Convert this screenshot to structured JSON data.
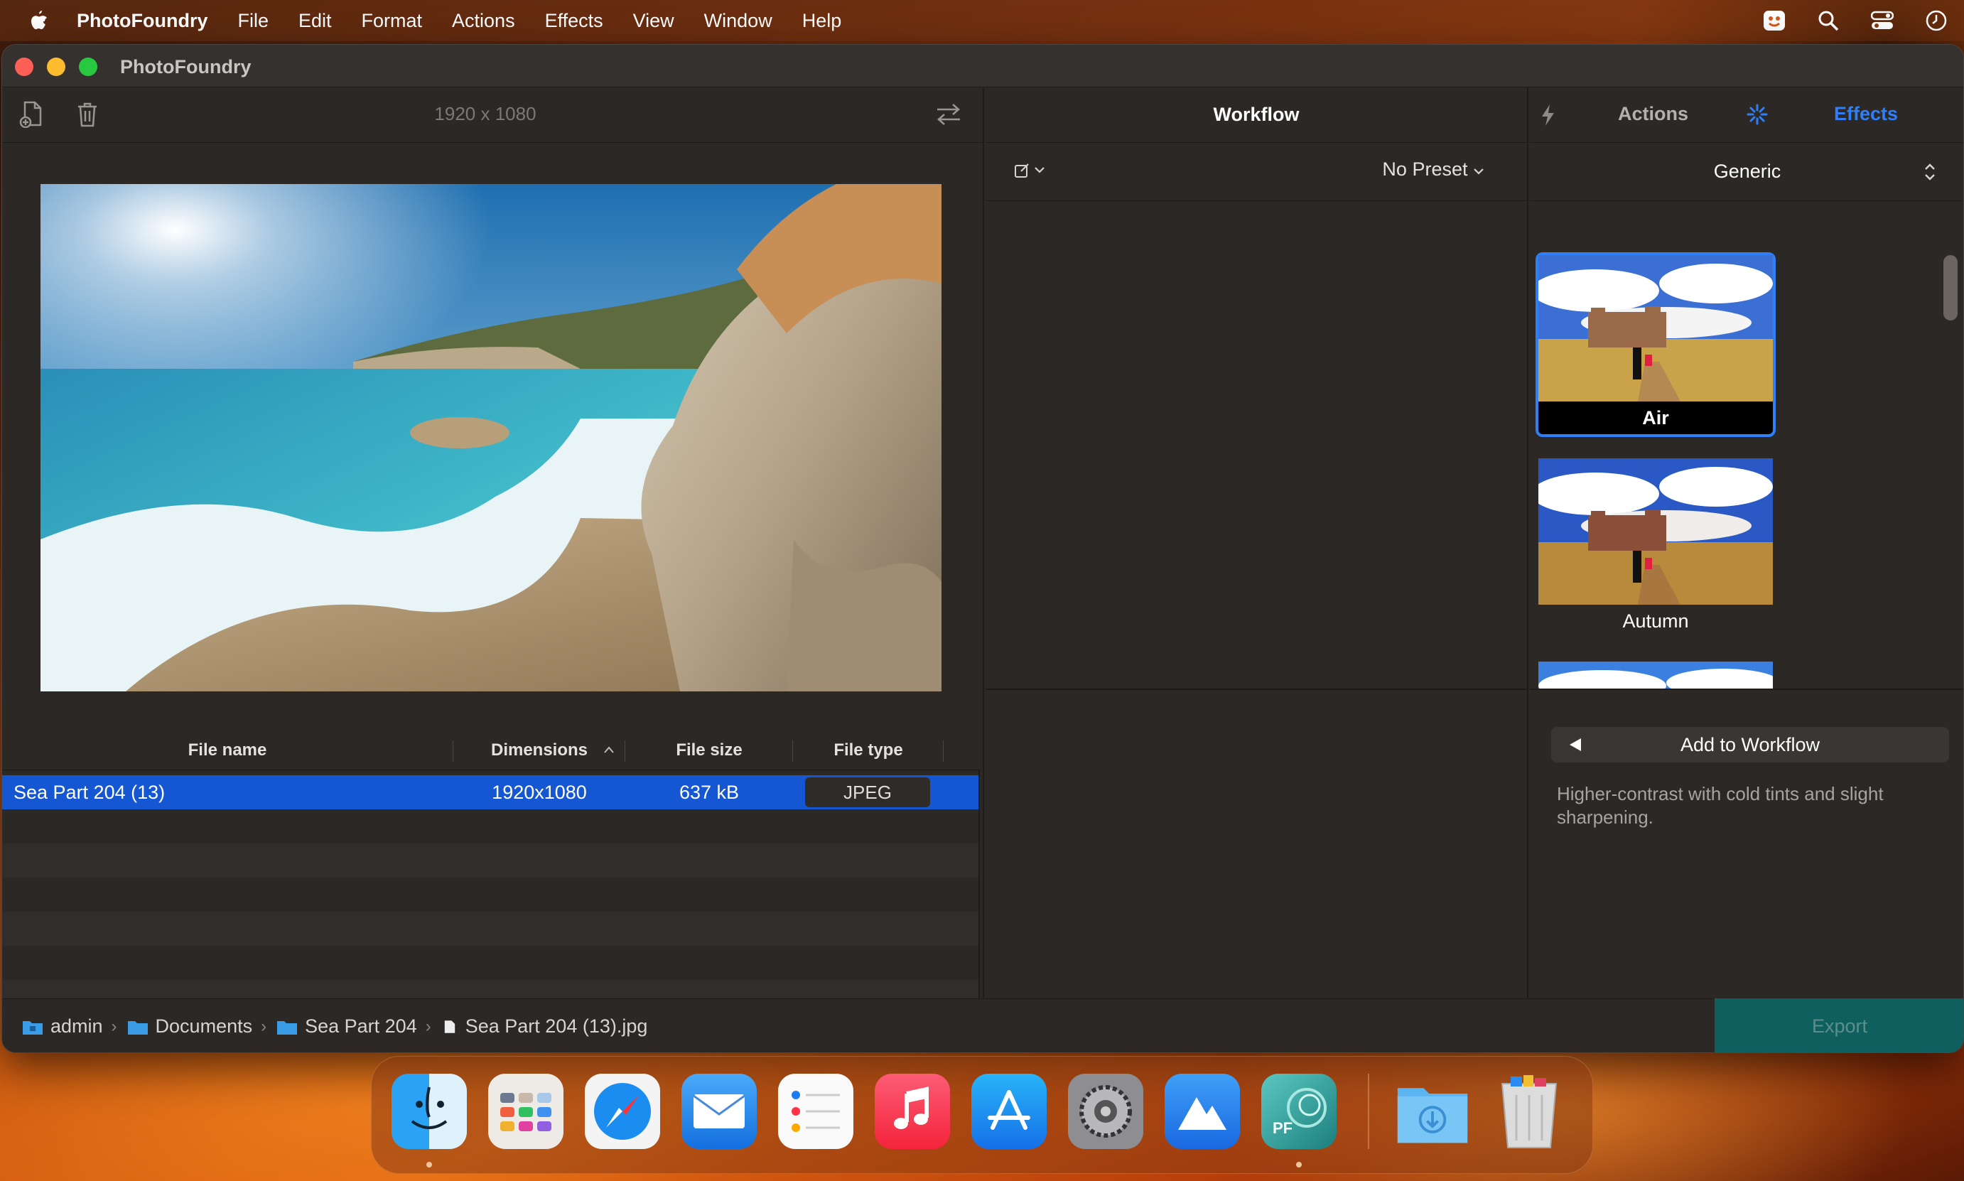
{
  "menubar": {
    "app_name": "PhotoFoundry",
    "items": [
      "File",
      "Edit",
      "Format",
      "Actions",
      "Effects",
      "View",
      "Window",
      "Help"
    ]
  },
  "window": {
    "title": "PhotoFoundry"
  },
  "left_panel": {
    "dimensions_label": "1920 x 1080",
    "table": {
      "columns": [
        "File name",
        "Dimensions",
        "File size",
        "File type"
      ],
      "sorted_column": "Dimensions",
      "rows": [
        {
          "name": "Sea Part 204 (13)",
          "dimensions": "1920x1080",
          "size": "637 kB",
          "type": "JPEG",
          "selected": true
        }
      ]
    }
  },
  "workflow": {
    "title": "Workflow",
    "preset": "No Preset"
  },
  "right_panel": {
    "tabs": {
      "actions": "Actions",
      "effects": "Effects"
    },
    "active_tab": "Effects",
    "category": "Generic",
    "effects": [
      {
        "name": "Air",
        "selected": true
      },
      {
        "name": "Autumn",
        "selected": false
      }
    ],
    "add_button": "Add to Workflow",
    "description": "Higher-contrast with cold tints and slight sharpening."
  },
  "pathbar": {
    "segments": [
      "admin",
      "Documents",
      "Sea Part 204",
      "Sea Part 204 (13).jpg"
    ]
  },
  "export_button": "Export",
  "colors": {
    "accent": "#2f7ff8",
    "selection": "#1557d2",
    "export_bg": "#0f5f5e"
  },
  "dock": {
    "apps": [
      "finder-icon",
      "launchpad-icon",
      "safari-icon",
      "mail-icon",
      "reminders-icon",
      "music-icon",
      "app-store-icon",
      "system-settings-icon",
      "photo-app-icon",
      "photofoundry-icon",
      "downloads-folder-icon",
      "trash-icon"
    ],
    "photofoundry_badge": "PF"
  }
}
